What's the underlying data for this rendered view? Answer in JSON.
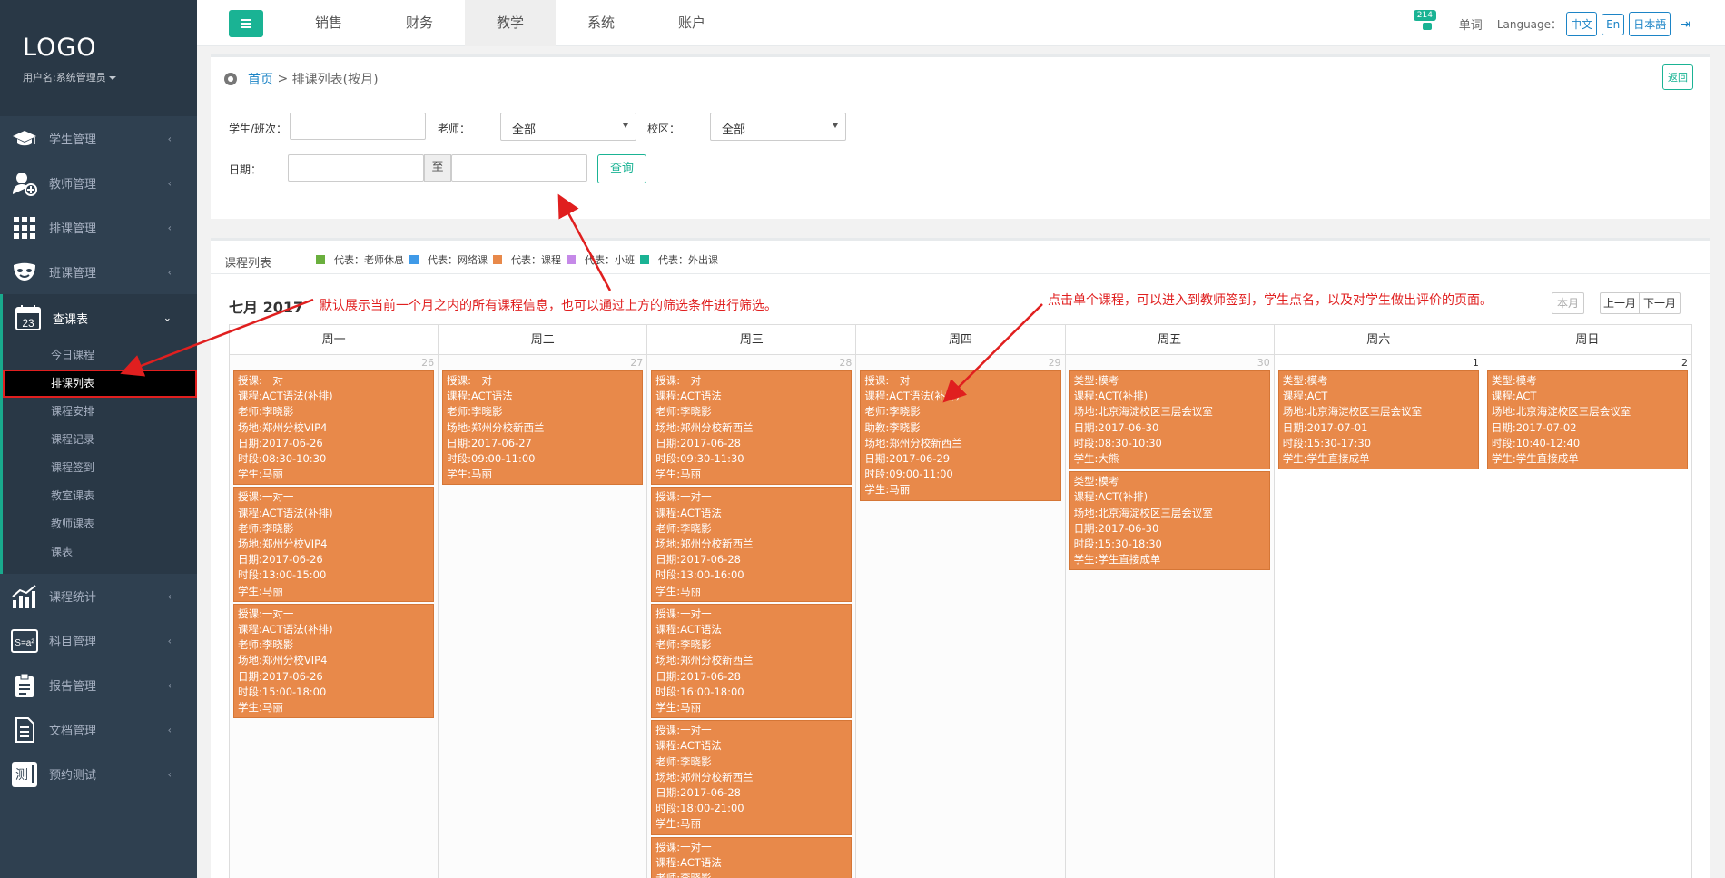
{
  "sidebar": {
    "logo": "LOGO",
    "user": "用户名:系统管理员",
    "items": [
      {
        "label": "学生管理",
        "icon": "graduation-cap-icon"
      },
      {
        "label": "教师管理",
        "icon": "teacher-add-icon"
      },
      {
        "label": "排课管理",
        "icon": "grid-icon"
      },
      {
        "label": "班课管理",
        "icon": "mask-icon"
      },
      {
        "label": "查课表",
        "icon": "calendar-icon",
        "calendar_day": "23"
      },
      {
        "label": "课程统计",
        "icon": "chart-icon"
      },
      {
        "label": "科目管理",
        "icon": "formula-icon"
      },
      {
        "label": "报告管理",
        "icon": "clipboard-icon"
      },
      {
        "label": "文档管理",
        "icon": "document-icon"
      },
      {
        "label": "预约测试",
        "icon": "test-icon",
        "icon_text": "测"
      }
    ],
    "subitems": [
      "今日课程",
      "排课列表",
      "课程安排",
      "课程记录",
      "课程签到",
      "教室课表",
      "教师课表",
      "课表"
    ]
  },
  "topbar": {
    "tabs": [
      "销售",
      "财务",
      "教学",
      "系统",
      "账户"
    ],
    "badge": "214",
    "word": "单词",
    "language_label": "Language：",
    "langs": [
      "中文",
      "En",
      "日本語"
    ]
  },
  "filter": {
    "crumb_home": "首页",
    "crumb_sep": " > ",
    "crumb_current": "排课列表(按月)",
    "back": "返回",
    "student_label": "学生/班次：",
    "teacher_label": "老师：",
    "teacher_value": "全部",
    "campus_label": "校区：",
    "campus_value": "全部",
    "date_label": "日期：",
    "date_to": "至",
    "query": "查询"
  },
  "calendar": {
    "list_title": "课程列表",
    "legend": [
      {
        "label": "代表：老师休息",
        "color": "#5cb85c"
      },
      {
        "label": "代表：网络课",
        "color": "#3f9ae8"
      },
      {
        "label": "代表：课程",
        "color": "#e8894a"
      },
      {
        "label": "代表：小班",
        "color": "#c589e8"
      },
      {
        "label": "代表：外出课",
        "color": "#1ab394"
      }
    ],
    "title": "七月 2017",
    "note1": "默认展示当前一个月之内的所有课程信息，也可以通过上方的筛选条件进行筛选。",
    "note2": "点击单个课程，可以进入到教师签到，学生点名，以及对学生做出评价的页面。",
    "btn_this_month": "本月",
    "btn_prev": "上一月",
    "btn_next": "下一月",
    "weekdays": [
      "周一",
      "周二",
      "周三",
      "周四",
      "周五",
      "周六",
      "周日"
    ],
    "days": [
      {
        "num": "26",
        "events": [
          [
            "授课:一对一",
            "课程:ACT语法(补排)",
            "老师:李晓影",
            "场地:郑州分校VIP4",
            "日期:2017-06-26",
            "时段:08:30-10:30",
            "学生:马丽"
          ],
          [
            "授课:一对一",
            "课程:ACT语法(补排)",
            "老师:李晓影",
            "场地:郑州分校VIP4",
            "日期:2017-06-26",
            "时段:13:00-15:00",
            "学生:马丽"
          ],
          [
            "授课:一对一",
            "课程:ACT语法(补排)",
            "老师:李晓影",
            "场地:郑州分校VIP4",
            "日期:2017-06-26",
            "时段:15:00-18:00",
            "学生:马丽"
          ]
        ]
      },
      {
        "num": "27",
        "events": [
          [
            "授课:一对一",
            "课程:ACT语法",
            "老师:李晓影",
            "场地:郑州分校新西兰",
            "日期:2017-06-27",
            "时段:09:00-11:00",
            "学生:马丽"
          ]
        ]
      },
      {
        "num": "28",
        "events": [
          [
            "授课:一对一",
            "课程:ACT语法",
            "老师:李晓影",
            "场地:郑州分校新西兰",
            "日期:2017-06-28",
            "时段:09:30-11:30",
            "学生:马丽"
          ],
          [
            "授课:一对一",
            "课程:ACT语法",
            "老师:李晓影",
            "场地:郑州分校新西兰",
            "日期:2017-06-28",
            "时段:13:00-16:00",
            "学生:马丽"
          ],
          [
            "授课:一对一",
            "课程:ACT语法",
            "老师:李晓影",
            "场地:郑州分校新西兰",
            "日期:2017-06-28",
            "时段:16:00-18:00",
            "学生:马丽"
          ],
          [
            "授课:一对一",
            "课程:ACT语法",
            "老师:李晓影",
            "场地:郑州分校新西兰",
            "日期:2017-06-28",
            "时段:18:00-21:00",
            "学生:马丽"
          ],
          [
            "授课:一对一",
            "课程:ACT语法",
            "老师:李晓影",
            "场地:郑州分校新西兰"
          ]
        ]
      },
      {
        "num": "29",
        "events": [
          [
            "授课:一对一",
            "课程:ACT语法(补排)",
            "老师:李晓影",
            "助教:李晓影",
            "场地:郑州分校新西兰",
            "日期:2017-06-29",
            "时段:09:00-11:00",
            "学生:马丽"
          ]
        ]
      },
      {
        "num": "30",
        "events": [
          [
            "类型:模考",
            "课程:ACT(补排)",
            "场地:北京海淀校区三层会议室",
            "日期:2017-06-30",
            "时段:08:30-10:30",
            "学生:大熊"
          ],
          [
            "类型:模考",
            "课程:ACT(补排)",
            "场地:北京海淀校区三层会议室",
            "日期:2017-06-30",
            "时段:15:30-18:30",
            "学生:学生直接成单"
          ]
        ]
      },
      {
        "num": "1",
        "events": [
          [
            "类型:模考",
            "课程:ACT",
            "场地:北京海淀校区三层会议室",
            "日期:2017-07-01",
            "时段:15:30-17:30",
            "学生:学生直接成单"
          ]
        ]
      },
      {
        "num": "2",
        "events": [
          [
            "类型:模考",
            "课程:ACT",
            "场地:北京海淀校区三层会议室",
            "日期:2017-07-02",
            "时段:10:40-12:40",
            "学生:学生直接成单"
          ]
        ]
      }
    ]
  }
}
